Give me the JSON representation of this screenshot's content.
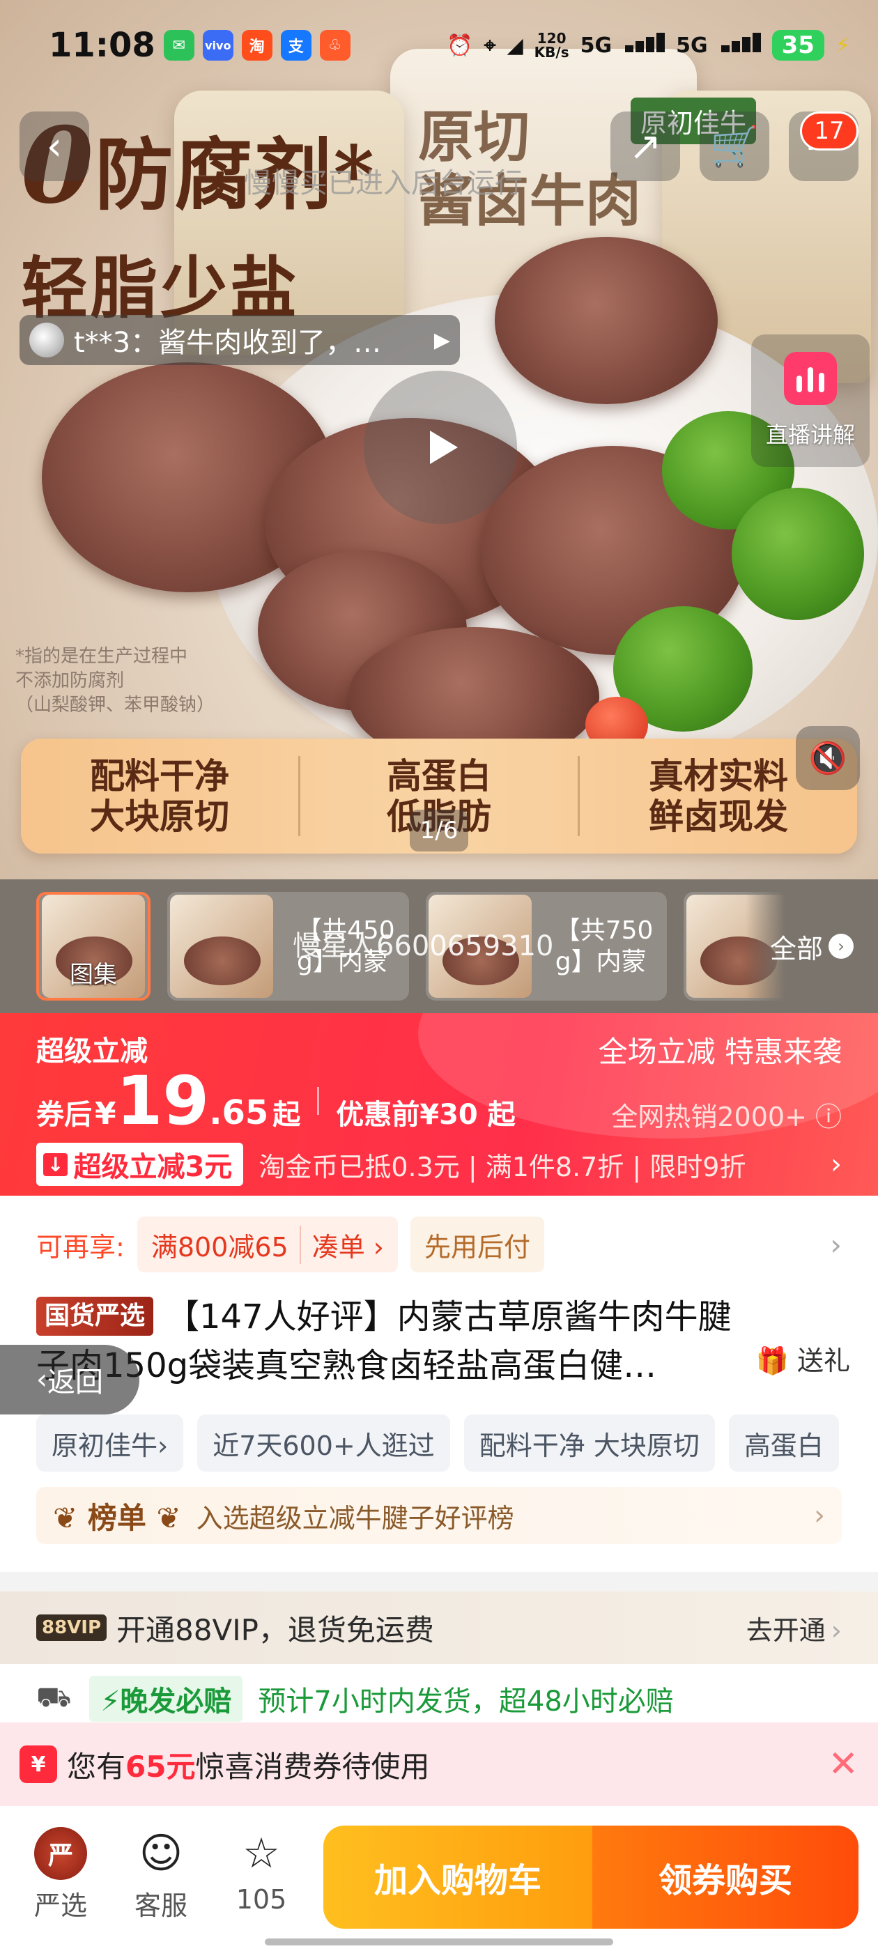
{
  "status_bar": {
    "time": "11:08",
    "speed": "120\nKB/s",
    "net1": "5G",
    "net2": "5G",
    "battery": "35"
  },
  "hero": {
    "headline_l1_zero": "0",
    "headline_l1_rest": "防腐剂*",
    "headline_l2": "轻脂少盐",
    "pack_title_l1": "原切",
    "pack_title_l2": "酱卤牛肉",
    "pack_brand": "原初佳牛",
    "watermark": "慢慢买已进入后台运行",
    "note_lines": [
      "*指的是在生产过程中",
      "不添加防腐剂",
      "（山梨酸钾、苯甲酸钠）"
    ],
    "banner": [
      {
        "l1": "配料干净",
        "l2": "大块原切"
      },
      {
        "l1": "高蛋白",
        "l2": "低脂肪"
      },
      {
        "l1": "真材实料",
        "l2": "鲜卤现发"
      }
    ],
    "ticker_text": "t**3：酱牛肉收到了，…",
    "live_label": "直播讲解",
    "cart_count": "17",
    "pager": "1/6"
  },
  "thumbs": {
    "first_label": "图集",
    "items": [
      {
        "caption_l1": "【共450",
        "caption_l2": "g】内蒙"
      },
      {
        "caption_l1": "【共750",
        "caption_l2": "g】内蒙"
      }
    ],
    "overlay": "慢星人6600659310",
    "all_label": "全部"
  },
  "price": {
    "title": "超级立减",
    "promo_right": "全场立减 特惠来袭",
    "prefix": "券后",
    "yen": "¥",
    "int": "19",
    "dec": ".65",
    "qi": "起",
    "orig": "优惠前¥30 起",
    "hot": "全网热销2000+ ⓘ",
    "tag": "超级立减3元",
    "info": "淘金币已抵0.3元 | 满1件8.7折 | 限时9折"
  },
  "offers": {
    "label": "可再享:",
    "tag_main": "满800减65",
    "tag_sub": "凑单 ›",
    "tag2": "先用后付"
  },
  "product": {
    "brand": "国货严选",
    "title_l1": "【147人好评】内蒙古草原酱牛肉牛腱",
    "title_l2": "子肉150g袋装真空熟食卤轻盐高蛋白健…",
    "gift": "送礼"
  },
  "back_label": "返回",
  "chips": [
    "原初佳牛›",
    "近7天600+人逛过",
    "配料干净 大块原切",
    "高蛋白"
  ],
  "rank": {
    "badge": "榜单",
    "text": "入选超级立减牛腱子好评榜"
  },
  "vip": {
    "tag": "88VIP",
    "text": "开通88VIP，退货免运费",
    "go": "去开通"
  },
  "ship": {
    "tag": "⚡晚发必赔",
    "text": "预计7小时内发货，超48小时必赔"
  },
  "coupon": {
    "icon": "¥",
    "pre": "您有",
    "amount": "65元",
    "post": "惊喜消费券待使用"
  },
  "bottom": {
    "store_label": "严选",
    "service_label": "客服",
    "fav_count": "105",
    "add_cart": "加入购物车",
    "buy": "领券购买"
  }
}
